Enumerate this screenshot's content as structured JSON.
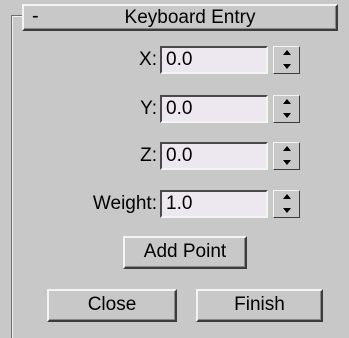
{
  "rollout": {
    "collapse_symbol": "-",
    "title": "Keyboard Entry"
  },
  "fields": {
    "x": {
      "label": "X:",
      "value": "0.0"
    },
    "y": {
      "label": "Y:",
      "value": "0.0"
    },
    "z": {
      "label": "Z:",
      "value": "0.0"
    },
    "weight": {
      "label": "Weight:",
      "value": "1.0"
    }
  },
  "buttons": {
    "add_point": "Add Point",
    "close": "Close",
    "finish": "Finish"
  },
  "colors": {
    "panel_bg": "#c8c8c8",
    "input_bg": "#ede8f0"
  }
}
